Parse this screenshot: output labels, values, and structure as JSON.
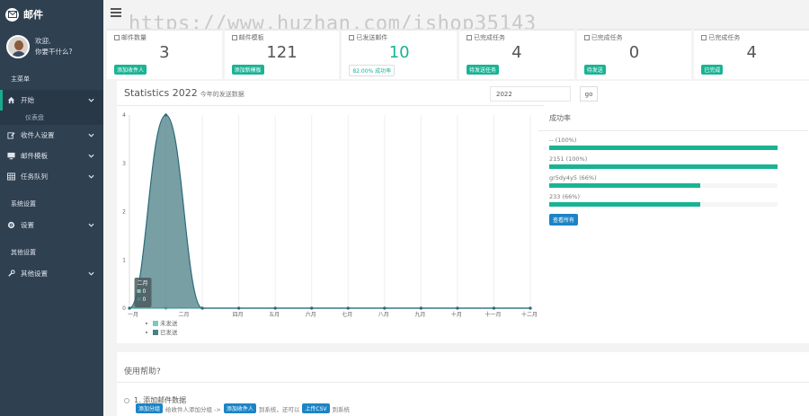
{
  "brand": {
    "title": "邮件"
  },
  "profile": {
    "line1": "欢迎,",
    "line2": "你要干什么?"
  },
  "sidebar": {
    "section_main": "主菜单",
    "items": [
      {
        "label": "开始",
        "icon": "home-icon",
        "active": true
      },
      {
        "label": "收件人设置",
        "icon": "edit-icon"
      },
      {
        "label": "邮件模板",
        "icon": "monitor-icon"
      },
      {
        "label": "任务队列",
        "icon": "table-icon"
      }
    ],
    "sub_item": "仪表盘",
    "section_system": "系统设置",
    "settings_item": "设置",
    "section_other": "其他设置",
    "other_item": "其他设置"
  },
  "watermark": "https://www.huzhan.com/ishop35143",
  "stats": [
    {
      "title": "邮件数量",
      "value": "3",
      "badge": "添加收件人"
    },
    {
      "title": "邮件模板",
      "value": "121",
      "badge": "添加新模板"
    },
    {
      "title": "已发送邮件",
      "value": "10",
      "badge": "82.00% 成功率"
    },
    {
      "title": "已完成任务",
      "value": "4",
      "badge": "待发送任务"
    },
    {
      "title": "已完成任务",
      "value": "0",
      "badge": "待发送"
    },
    {
      "title": "已完成任务",
      "value": "4",
      "badge": "已完成"
    }
  ],
  "chart_panel": {
    "title": "Statistics 2022",
    "subtitle": "今年的发送数据",
    "year_value": "2022",
    "go_label": "go",
    "tooltip": {
      "month": "二月",
      "val1": "0",
      "val2": "0"
    }
  },
  "chart_data": {
    "type": "area",
    "categories": [
      "一月",
      "二月",
      "三月",
      "四月",
      "五月",
      "六月",
      "七月",
      "八月",
      "九月",
      "十月",
      "十一月",
      "十二月"
    ],
    "x_tick_labels": [
      "一月",
      "二月",
      "四月",
      "五月",
      "六月",
      "七月",
      "八月",
      "九月",
      "十月",
      "十一月",
      "十二月"
    ],
    "series": [
      {
        "name": "未发送",
        "values": [
          0,
          0,
          0,
          0,
          0,
          0,
          0,
          0,
          0,
          0,
          0,
          0
        ],
        "color": "#7fc6bd"
      },
      {
        "name": "已发送",
        "values": [
          0,
          4,
          0,
          0,
          0,
          0,
          0,
          0,
          0,
          0,
          0,
          0
        ],
        "color": "#4b7f86"
      }
    ],
    "ylim": [
      0,
      4
    ],
    "yticks": [
      "0",
      "1",
      "2",
      "3",
      "4"
    ],
    "grid": true,
    "legend": "bottom-left"
  },
  "success_rate": {
    "title": "成功率",
    "items": [
      {
        "label": "-- (100%)",
        "pct": 1.0
      },
      {
        "label": "2151 (100%)",
        "pct": 1.0
      },
      {
        "label": "gr5dy4y5 (66%)",
        "pct": 0.66
      },
      {
        "label": "233 (66%)",
        "pct": 0.66
      }
    ],
    "button": "查看所有"
  },
  "help": {
    "title": "使用帮助?",
    "step1": "1. 添加邮件数据",
    "tag1": "添加分组",
    "text1": "给收件人添加分组 ->",
    "tag2": "添加收件人",
    "text2": "到系统，还可以",
    "tag3": "上传CSV",
    "text3": "到系统"
  },
  "colors": {
    "accent": "#1ab394",
    "sidebar": "#2f4050",
    "blue": "#1c84c6"
  }
}
